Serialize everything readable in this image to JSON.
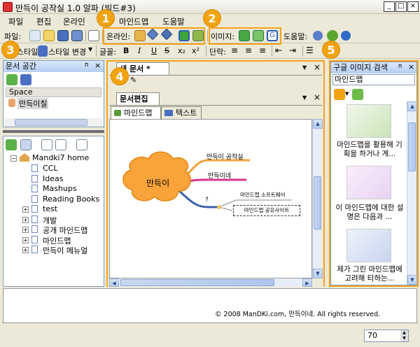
{
  "window": {
    "title": "만득이 공작실 1.0 알파 (빌드#3)",
    "min": "_",
    "max": "□",
    "close": "×"
  },
  "menu": [
    "파일",
    "편집",
    "온라인",
    "마인드맵",
    "도움말"
  ],
  "toolbar1": {
    "file_label": "파일:",
    "online_label": "온라인:",
    "image_label": "이미지:",
    "help_label": "도움말:"
  },
  "toolbar2": {
    "style_label": "스타일:",
    "style_change": "스타일 변경",
    "font_label": "글꼴:",
    "para_label": "단락:",
    "bold": "B",
    "italic": "I",
    "underline": "U",
    "strike": "S",
    "sub": "x₂",
    "sup": "x²"
  },
  "badges": [
    "1",
    "2",
    "3",
    "4",
    "5"
  ],
  "doc_space": {
    "title": "문서 공간",
    "space_header": "Space",
    "space_item": "만득이칠",
    "tree_root": "Mandki7 home",
    "tree_items": [
      "CCL",
      "Ideas",
      "Mashups",
      "Reading Books",
      "test",
      "개발",
      "공개 마인드맵",
      "마인드맵",
      "만득이 메뉴얼"
    ]
  },
  "editor": {
    "doc_tab": "새 문서",
    "doc_tab_mark": "*",
    "edit_tab": "문서편집",
    "sub_tabs": [
      "마인드맵",
      "텍스트"
    ],
    "mindmap": {
      "central": "만득이",
      "branches": [
        "만득이 공작실",
        "만득이네",
        "?"
      ],
      "sub_branches": [
        "마인드맵 소프트웨어",
        "마인드맵 공유사이트"
      ]
    }
  },
  "image_search": {
    "title": "구글 이미지 검색",
    "query": "마인드맵",
    "results": [
      {
        "caption": "마인드맵을 활용해 기획을 하거나 계..."
      },
      {
        "caption": "이 마인드맵에 대한 설명은 다음과 ..."
      },
      {
        "caption": "제가 그린 마인드맵에 고려해 티하는..."
      }
    ]
  },
  "footer": {
    "copyright": "© 2008 ManDKi.com, 만득이네. All rights reserved.",
    "zoom": "70"
  },
  "colors": {
    "accent": "#f2a312",
    "central_node": "#f9a33a",
    "branch1": "#f4a13a",
    "branch2": "#d6368b",
    "branch3": "#3a62a8"
  }
}
